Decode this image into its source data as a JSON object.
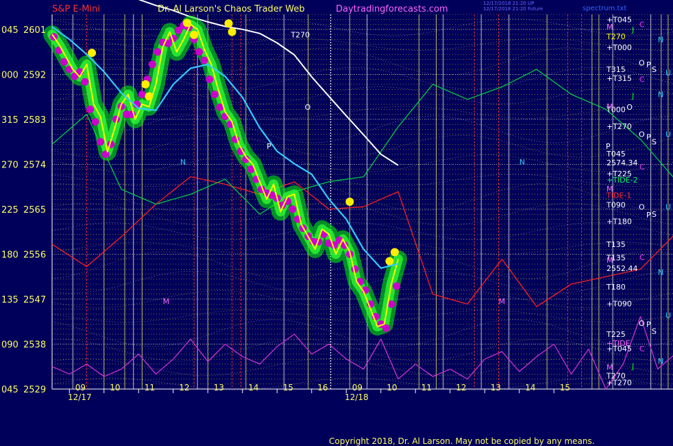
{
  "header": {
    "left_title": "S&P E-Mini",
    "center_title": "Dr. Al Larson's Chaos Trader Web",
    "site": "Daytradingforecasts.com",
    "timestamp_1": "12/17/2018 21:20 UP",
    "timestamp_2": "12/17/2018 21:20 Future",
    "right_tag": "spectrum.txt"
  },
  "footer": {
    "copyright": "Copyright 2018, Dr. Al Larson. May not be copied by any means."
  },
  "colors": {
    "background": "#00005a",
    "price_grid": "#ffff00",
    "price_line": "#ffff00",
    "bands": "#00ff00",
    "energy_dots": "#cc00cc",
    "fast_ma": "#33ccff",
    "slow_ma": "#ffffff",
    "tide_1": "#ff2020",
    "tide_2": "#00cc44",
    "tide_3": "#cc33cc",
    "vlines": "#ffff66"
  },
  "chart_data": {
    "type": "line",
    "title": "S&P E-Mini",
    "ylim": [
      2529,
      2604
    ],
    "price_ticks": [
      2601,
      2592,
      2583,
      2574,
      2565,
      2556,
      2547,
      2538,
      2529
    ],
    "angle_ticks": [
      "045",
      "000",
      "315",
      "270",
      "225",
      "180",
      "135",
      "090",
      "045"
    ],
    "x_ticks": [
      "09",
      "10",
      "11",
      "12",
      "13",
      "14",
      "15",
      "16",
      "09",
      "10",
      "11",
      "12",
      "13",
      "14",
      "15"
    ],
    "date_labels": [
      "12/17",
      "12/18"
    ],
    "right_labels": [
      {
        "text": "+T045",
        "color": "#ffffff",
        "price": 2603.0
      },
      {
        "text": "T270",
        "color": "#ffff00",
        "price": 2599.6
      },
      {
        "text": "+T000",
        "color": "#ffffff",
        "price": 2597.4
      },
      {
        "text": "T315",
        "color": "#ffffff",
        "price": 2593.0
      },
      {
        "text": "+T315",
        "color": "#ffffff",
        "price": 2591.2
      },
      {
        "text": "T000",
        "color": "#ffffff",
        "price": 2585.0
      },
      {
        "text": "+T270",
        "color": "#ffffff",
        "price": 2581.6
      },
      {
        "text": "T045",
        "color": "#ffffff",
        "price": 2576.1
      },
      {
        "text": "2574.34",
        "color": "#ffffff",
        "price": 2574.3
      },
      {
        "text": "+T225",
        "color": "#ffffff",
        "price": 2572.1
      },
      {
        "text": "+TIDE-2",
        "color": "#00ff66",
        "price": 2570.9
      },
      {
        "text": "TIDE-1",
        "color": "#ff3030",
        "price": 2567.8
      },
      {
        "text": "T090",
        "color": "#ffffff",
        "price": 2565.9
      },
      {
        "text": "+T180",
        "color": "#ffffff",
        "price": 2562.6
      },
      {
        "text": "T135",
        "color": "#ffffff",
        "price": 2558.0
      },
      {
        "text": "T135",
        "color": "#ffffff",
        "price": 2555.3
      },
      {
        "text": "2552.44",
        "color": "#ffffff",
        "price": 2553.2
      },
      {
        "text": "T180",
        "color": "#ffffff",
        "price": 2549.5
      },
      {
        "text": "+T090",
        "color": "#ffffff",
        "price": 2546.1
      },
      {
        "text": "T225",
        "color": "#ffffff",
        "price": 2540.0
      },
      {
        "text": "+TIDE",
        "color": "#ff66ff",
        "price": 2538.2
      },
      {
        "text": "+T045",
        "color": "#ffffff",
        "price": 2537.1
      },
      {
        "text": "T270",
        "color": "#ffffff",
        "price": 2531.7
      },
      {
        "text": "+T270",
        "color": "#ffffff",
        "price": 2530.3
      }
    ],
    "right_markers": [
      {
        "text": "M",
        "color": "#ff66ff",
        "price": 2601.5
      },
      {
        "text": "J",
        "color": "#00ff00",
        "price": 2601.0
      },
      {
        "text": "O",
        "color": "#ffffff",
        "price": 2594.3
      },
      {
        "text": "S",
        "color": "#ffffff",
        "price": 2593.0
      },
      {
        "text": "M",
        "color": "#ff66ff",
        "price": 2585.6
      },
      {
        "text": "J",
        "color": "#00ff00",
        "price": 2587.7
      },
      {
        "text": "O",
        "color": "#ffffff",
        "price": 2580.0
      },
      {
        "text": "S",
        "color": "#ffffff",
        "price": 2578.5
      },
      {
        "text": "M",
        "color": "#ff66ff",
        "price": 2569.1
      },
      {
        "text": "O",
        "color": "#ffffff",
        "price": 2565.5
      },
      {
        "text": "S",
        "color": "#ffffff",
        "price": 2564.0
      },
      {
        "text": "M",
        "color": "#ff66ff",
        "price": 2554.8
      },
      {
        "text": "O",
        "color": "#ffffff",
        "price": 2542.2
      },
      {
        "text": "S",
        "color": "#ffffff",
        "price": 2540.6
      },
      {
        "text": "M",
        "color": "#ff66ff",
        "price": 2533.4
      },
      {
        "text": "J",
        "color": "#00ff00",
        "price": 2533.6
      }
    ],
    "far_right": [
      {
        "text": "C",
        "color": "#ff33ff",
        "price": 2602.0
      },
      {
        "text": "N",
        "color": "#33ccff",
        "price": 2599.0
      },
      {
        "text": "P",
        "color": "#ffffff",
        "price": 2594.0
      },
      {
        "text": "U",
        "color": "#33ccff",
        "price": 2592.3
      },
      {
        "text": "C",
        "color": "#ff33ff",
        "price": 2591.0
      },
      {
        "text": "N",
        "color": "#33ccff",
        "price": 2588.0
      },
      {
        "text": "P",
        "color": "#ffffff",
        "price": 2579.5
      },
      {
        "text": "U",
        "color": "#33ccff",
        "price": 2580.0
      },
      {
        "text": "C",
        "color": "#ff33ff",
        "price": 2573.5
      },
      {
        "text": "P",
        "color": "#ffffff",
        "price": 2563.9
      },
      {
        "text": "U",
        "color": "#33ccff",
        "price": 2565.5
      },
      {
        "text": "C",
        "color": "#ff33ff",
        "price": 2555.4
      },
      {
        "text": "N",
        "color": "#33ccff",
        "price": 2552.4
      },
      {
        "text": "P",
        "color": "#ffffff",
        "price": 2542.0
      },
      {
        "text": "U",
        "color": "#33ccff",
        "price": 2543.8
      },
      {
        "text": "C",
        "color": "#ff33ff",
        "price": 2537.1
      },
      {
        "text": "N",
        "color": "#33ccff",
        "price": 2534.6
      }
    ],
    "chart_markers": [
      {
        "text": "T270",
        "color": "#ffffff",
        "slot": 6.9,
        "price": 2599.4
      },
      {
        "text": "T270",
        "color": "#ffffff",
        "slot": 18.0,
        "price": 2599.4
      },
      {
        "text": "O",
        "color": "#ffffff",
        "slot": 7.3,
        "price": 2584.9
      },
      {
        "text": "O",
        "color": "#ffffff",
        "slot": 16.6,
        "price": 2584.9
      },
      {
        "text": "N",
        "color": "#33ccff",
        "slot": 3.7,
        "price": 2573.9
      },
      {
        "text": "N",
        "color": "#33ccff",
        "slot": 13.5,
        "price": 2573.9
      },
      {
        "text": "P",
        "color": "#ffffff",
        "slot": 6.2,
        "price": 2577.1
      },
      {
        "text": "P",
        "color": "#ffffff",
        "slot": 16.0,
        "price": 2577.1
      },
      {
        "text": "M",
        "color": "#ff66ff",
        "slot": 3.2,
        "price": 2546.0
      },
      {
        "text": "M",
        "color": "#ff66ff",
        "slot": 12.9,
        "price": 2546.0
      }
    ],
    "price_series": {
      "name": "S&P E-Mini",
      "x": [
        0.0,
        0.2,
        0.4,
        0.6,
        0.8,
        1.0,
        1.2,
        1.4,
        1.6,
        1.8,
        2.0,
        2.2,
        2.4,
        2.6,
        2.8,
        3.0,
        3.2,
        3.4,
        3.6,
        3.8,
        4.0,
        4.2,
        4.4,
        4.6,
        4.8,
        5.0,
        5.2,
        5.4,
        5.6,
        5.8,
        6.0,
        6.2,
        6.4,
        6.6,
        6.8,
        7.0,
        7.2,
        7.4,
        7.6,
        7.8,
        8.0,
        8.2,
        8.4,
        8.6,
        8.8,
        9.0,
        9.2,
        9.4,
        9.6,
        9.8,
        10.0
      ],
      "values": [
        2600.0,
        2598.0,
        2595.5,
        2593.0,
        2591.5,
        2594.0,
        2586.0,
        2583.5,
        2576.5,
        2581.0,
        2586.0,
        2588.0,
        2583.0,
        2586.0,
        2585.5,
        2590.0,
        2597.5,
        2600.5,
        2596.5,
        2599.0,
        2602.0,
        2601.0,
        2597.0,
        2594.0,
        2589.0,
        2584.5,
        2582.5,
        2578.0,
        2575.5,
        2574.0,
        2570.5,
        2567.0,
        2570.0,
        2564.5,
        2567.5,
        2568.0,
        2562.0,
        2559.5,
        2557.0,
        2561.0,
        2560.0,
        2556.0,
        2559.0,
        2556.5,
        2550.5,
        2548.5,
        2545.0,
        2541.5,
        2542.0,
        2550.0,
        2555.0
      ]
    },
    "fast_ma": {
      "name": "fast average",
      "x": [
        0,
        0.5,
        1,
        1.5,
        2,
        2.5,
        3,
        3.5,
        4,
        4.5,
        5,
        5.5,
        6,
        6.5,
        7,
        7.5,
        8,
        8.5,
        9,
        9.5,
        10
      ],
      "values": [
        2601.5,
        2599,
        2596,
        2592.5,
        2588.3,
        2585.2,
        2584.8,
        2590,
        2593.2,
        2594,
        2591.6,
        2587.4,
        2581.3,
        2576.6,
        2574.1,
        2572,
        2567,
        2563,
        2557,
        2553.2,
        2554.1
      ]
    },
    "slow_ma": {
      "name": "slow average",
      "x": [
        2.5,
        3,
        3.5,
        4,
        4.5,
        5,
        5.5,
        6,
        6.5,
        7,
        7.5,
        8,
        8.5,
        9,
        9.5,
        10
      ],
      "values": [
        2607,
        2605.8,
        2604.8,
        2603.5,
        2602.5,
        2601.6,
        2601,
        2600.2,
        2598.3,
        2595.9,
        2591.5,
        2587.6,
        2583.7,
        2579.9,
        2576,
        2573.8
      ]
    },
    "tide_series": [
      {
        "name": "TIDE-1",
        "color": "#ff2020",
        "x": [
          0,
          1,
          2,
          3,
          4,
          5,
          6,
          7,
          8,
          9,
          10,
          11,
          12,
          13,
          14,
          15,
          16,
          17,
          18,
          19,
          20
        ],
        "values": [
          2558,
          2553.5,
          2559.5,
          2566,
          2571.5,
          2570,
          2568,
          2570.5,
          2565,
          2565.5,
          2568.5,
          2548,
          2546,
          2555,
          2545.5,
          2550,
          2551.5,
          2553,
          2560,
          2563,
          2569
        ]
      },
      {
        "name": "TIDE-2",
        "color": "#00cc44",
        "x": [
          0,
          1,
          2,
          3,
          4,
          5,
          6,
          7,
          8,
          9,
          10,
          11,
          12,
          13,
          14,
          15,
          16,
          17,
          18,
          19,
          20
        ],
        "values": [
          2578,
          2584,
          2569,
          2566,
          2568,
          2571,
          2564,
          2568.5,
          2570.5,
          2571.5,
          2581.5,
          2590,
          2587,
          2589.5,
          2593,
          2588,
          2585,
          2579,
          2571,
          2570,
          2568
        ]
      },
      {
        "name": "TIDE",
        "color": "#cc33cc",
        "x": [
          0,
          0.5,
          1,
          1.5,
          2,
          2.5,
          3,
          3.5,
          4,
          4.5,
          5,
          5.5,
          6,
          6.5,
          7,
          7.5,
          8,
          8.5,
          9,
          9.5,
          10,
          10.5,
          11,
          11.5,
          12,
          12.5,
          13,
          13.5,
          14,
          14.5,
          15,
          15.5,
          16,
          16.5,
          17,
          17.5,
          18,
          18.5,
          19,
          19.5,
          20
        ],
        "values": [
          2533.5,
          2532,
          2534,
          2531.5,
          2533,
          2536,
          2532,
          2535,
          2539,
          2534.5,
          2538,
          2535.5,
          2534,
          2537.5,
          2540,
          2536,
          2538,
          2535,
          2533,
          2539,
          2531,
          2534,
          2531.5,
          2533,
          2531,
          2535,
          2536.5,
          2532.5,
          2535.5,
          2538,
          2532,
          2537,
          2529,
          2534,
          2543.5,
          2533,
          2536,
          2539,
          2531,
          2534,
          2539
        ]
      }
    ],
    "vertical_lines": {
      "white": [
        0.6,
        2.35,
        4.2,
        6.7,
        9.1,
        11.3,
        12.4,
        13.2,
        16.2,
        17.3,
        19.1
      ],
      "yellow": [
        1.5,
        2.1,
        2.6,
        4.5,
        5.6,
        7.4,
        8.6,
        10.6,
        11.1,
        14.3,
        15.6,
        15.8,
        17.6,
        17.8,
        18.5
      ],
      "red": [
        1.0,
        4.1,
        5.2,
        5.45,
        12.2,
        12.9,
        14.9,
        15.3
      ]
    },
    "energy_points": {
      "x": [
        0.05,
        0.2,
        0.35,
        0.5,
        0.65,
        0.8,
        0.95,
        1.1,
        1.25,
        1.4,
        1.55,
        1.7,
        1.85,
        2.0,
        2.15,
        2.3,
        2.45,
        2.6,
        2.75,
        2.9,
        3.05,
        3.2,
        3.35,
        3.5,
        3.65,
        3.8,
        3.95,
        4.1,
        4.25,
        4.4,
        4.55,
        4.7,
        4.85,
        5.0,
        5.15,
        5.3,
        5.45,
        5.6,
        5.75,
        5.9,
        6.05,
        6.2,
        6.35,
        6.5,
        6.65,
        6.8,
        6.95,
        7.1,
        7.25,
        7.4,
        7.55,
        7.7,
        7.85,
        8.0,
        8.15,
        8.3,
        8.45,
        8.6,
        8.75,
        8.9,
        9.05,
        9.2,
        9.35,
        9.5,
        9.65,
        9.8,
        9.95
      ],
      "values": [
        2599.5,
        2596.8,
        2594.5,
        2593,
        2591.6,
        2592.5,
        2590.5,
        2585,
        2582.5,
        2578.5,
        2576,
        2578,
        2583,
        2585.6,
        2584,
        2584,
        2586,
        2588,
        2591,
        2594,
        2596.5,
        2598.4,
        2598.2,
        2599.2,
        2600.8,
        2601.8,
        2601.4,
        2599,
        2596.5,
        2594.8,
        2591,
        2588,
        2585.4,
        2583.6,
        2582,
        2579,
        2576.6,
        2575,
        2573,
        2571,
        2569,
        2568.2,
        2567.8,
        2567.2,
        2565.8,
        2566.6,
        2565,
        2563,
        2561.2,
        2559.6,
        2558.5,
        2558.5,
        2560,
        2558.2,
        2557.8,
        2558.8,
        2557.8,
        2556,
        2553,
        2550.5,
        2548.8,
        2546,
        2543.5,
        2542,
        2541.2,
        2546,
        2549.6
      ]
    },
    "gold_points": {
      "x": [
        1.15,
        2.7,
        2.8,
        3.9,
        4.1,
        5.1,
        5.2,
        8.6,
        9.75,
        9.9
      ],
      "values": [
        2596.3,
        2590.0,
        2587.6,
        2602.3,
        2599.9,
        2602.2,
        2600.5,
        2566.5,
        2554.6,
        2556.4
      ]
    }
  }
}
